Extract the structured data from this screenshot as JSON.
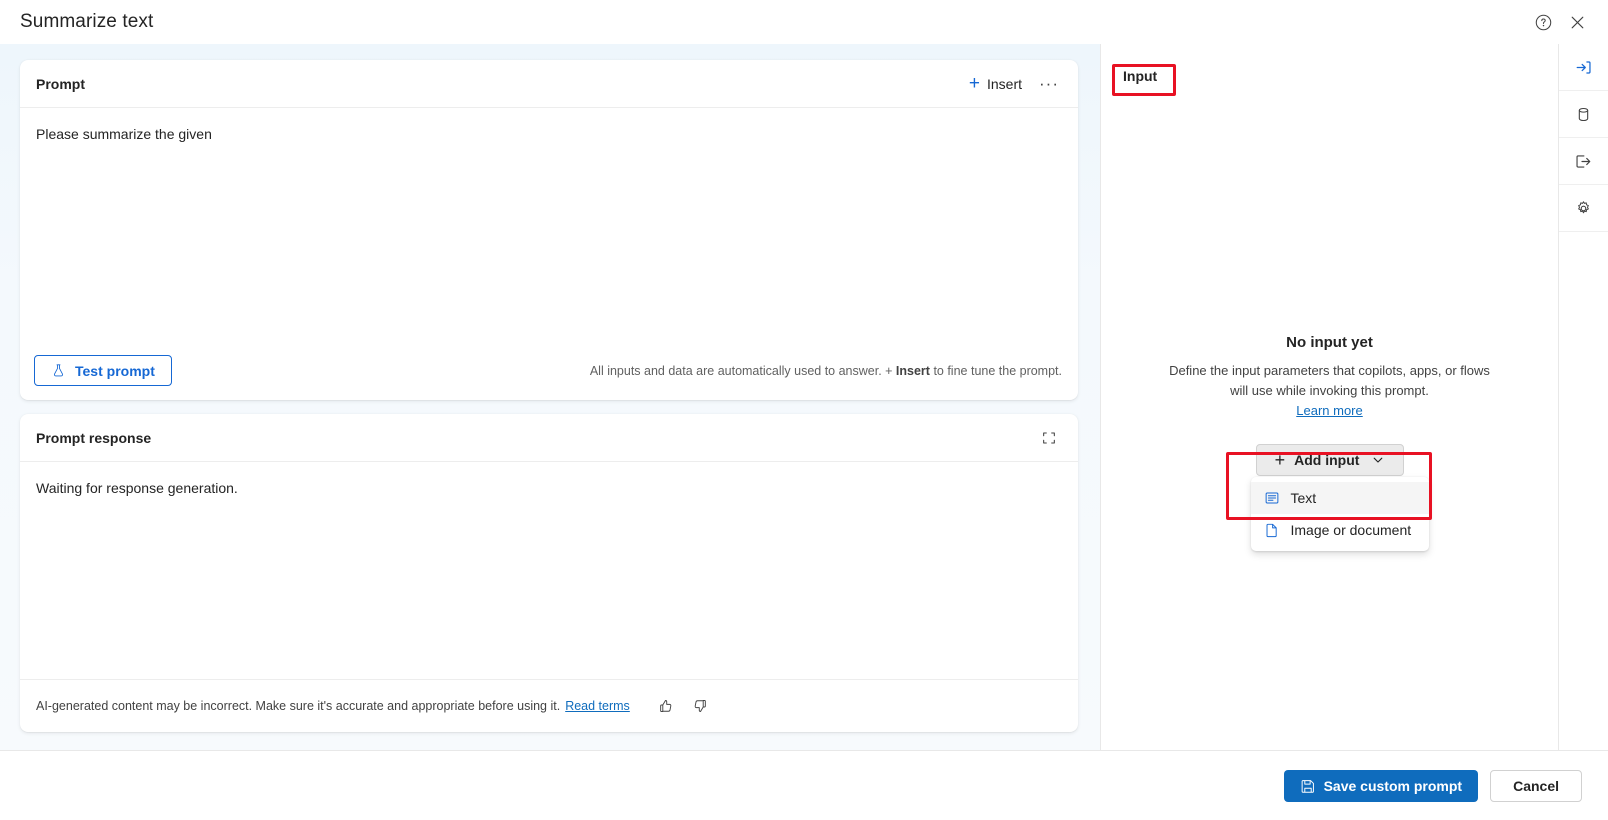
{
  "window": {
    "title": "Summarize text",
    "help_icon": "help-circle-icon",
    "close_icon": "close-icon"
  },
  "prompt_card": {
    "title": "Prompt",
    "insert_label": "Insert",
    "more_label": "···",
    "text": "Please summarize the given",
    "test_prompt_label": "Test prompt",
    "hint_before": "All inputs and data are automatically used to answer. + ",
    "hint_bold": "Insert",
    "hint_after": " to fine tune the prompt."
  },
  "response_card": {
    "title": "Prompt response",
    "expand_icon": "expand-icon",
    "text": "Waiting for response generation.",
    "disclaimer": "AI-generated content may be incorrect. Make sure it's accurate and appropriate before using it.",
    "read_terms": "Read terms",
    "thumbs_up_icon": "thumbs-up-icon",
    "thumbs_down_icon": "thumbs-down-icon"
  },
  "input_panel": {
    "heading": "Input",
    "empty_title": "No input yet",
    "empty_desc": "Define the input parameters that copilots, apps, or flows will use while invoking this prompt.",
    "learn_more": "Learn more",
    "add_input_label": "Add input",
    "menu_items": [
      {
        "label": "Text",
        "icon": "text-input-icon",
        "hovered": true
      },
      {
        "label": "Image or document",
        "icon": "document-icon",
        "hovered": false
      }
    ]
  },
  "rail": {
    "items": [
      {
        "name": "input-rail-icon",
        "active": true
      },
      {
        "name": "data-rail-icon",
        "active": false
      },
      {
        "name": "output-rail-icon",
        "active": false
      },
      {
        "name": "settings-rail-icon",
        "active": false
      }
    ]
  },
  "footer": {
    "save_label": "Save custom prompt",
    "cancel_label": "Cancel",
    "save_icon": "save-disk-icon"
  },
  "annotations": {
    "highlight_color": "#e81123",
    "boxes": [
      "input-heading-highlight",
      "add-input-highlight"
    ]
  },
  "colors": {
    "accent": "#0f6cbd",
    "link": "#0f6cbd",
    "canvas": "#f3f8fc",
    "card": "#ffffff"
  }
}
